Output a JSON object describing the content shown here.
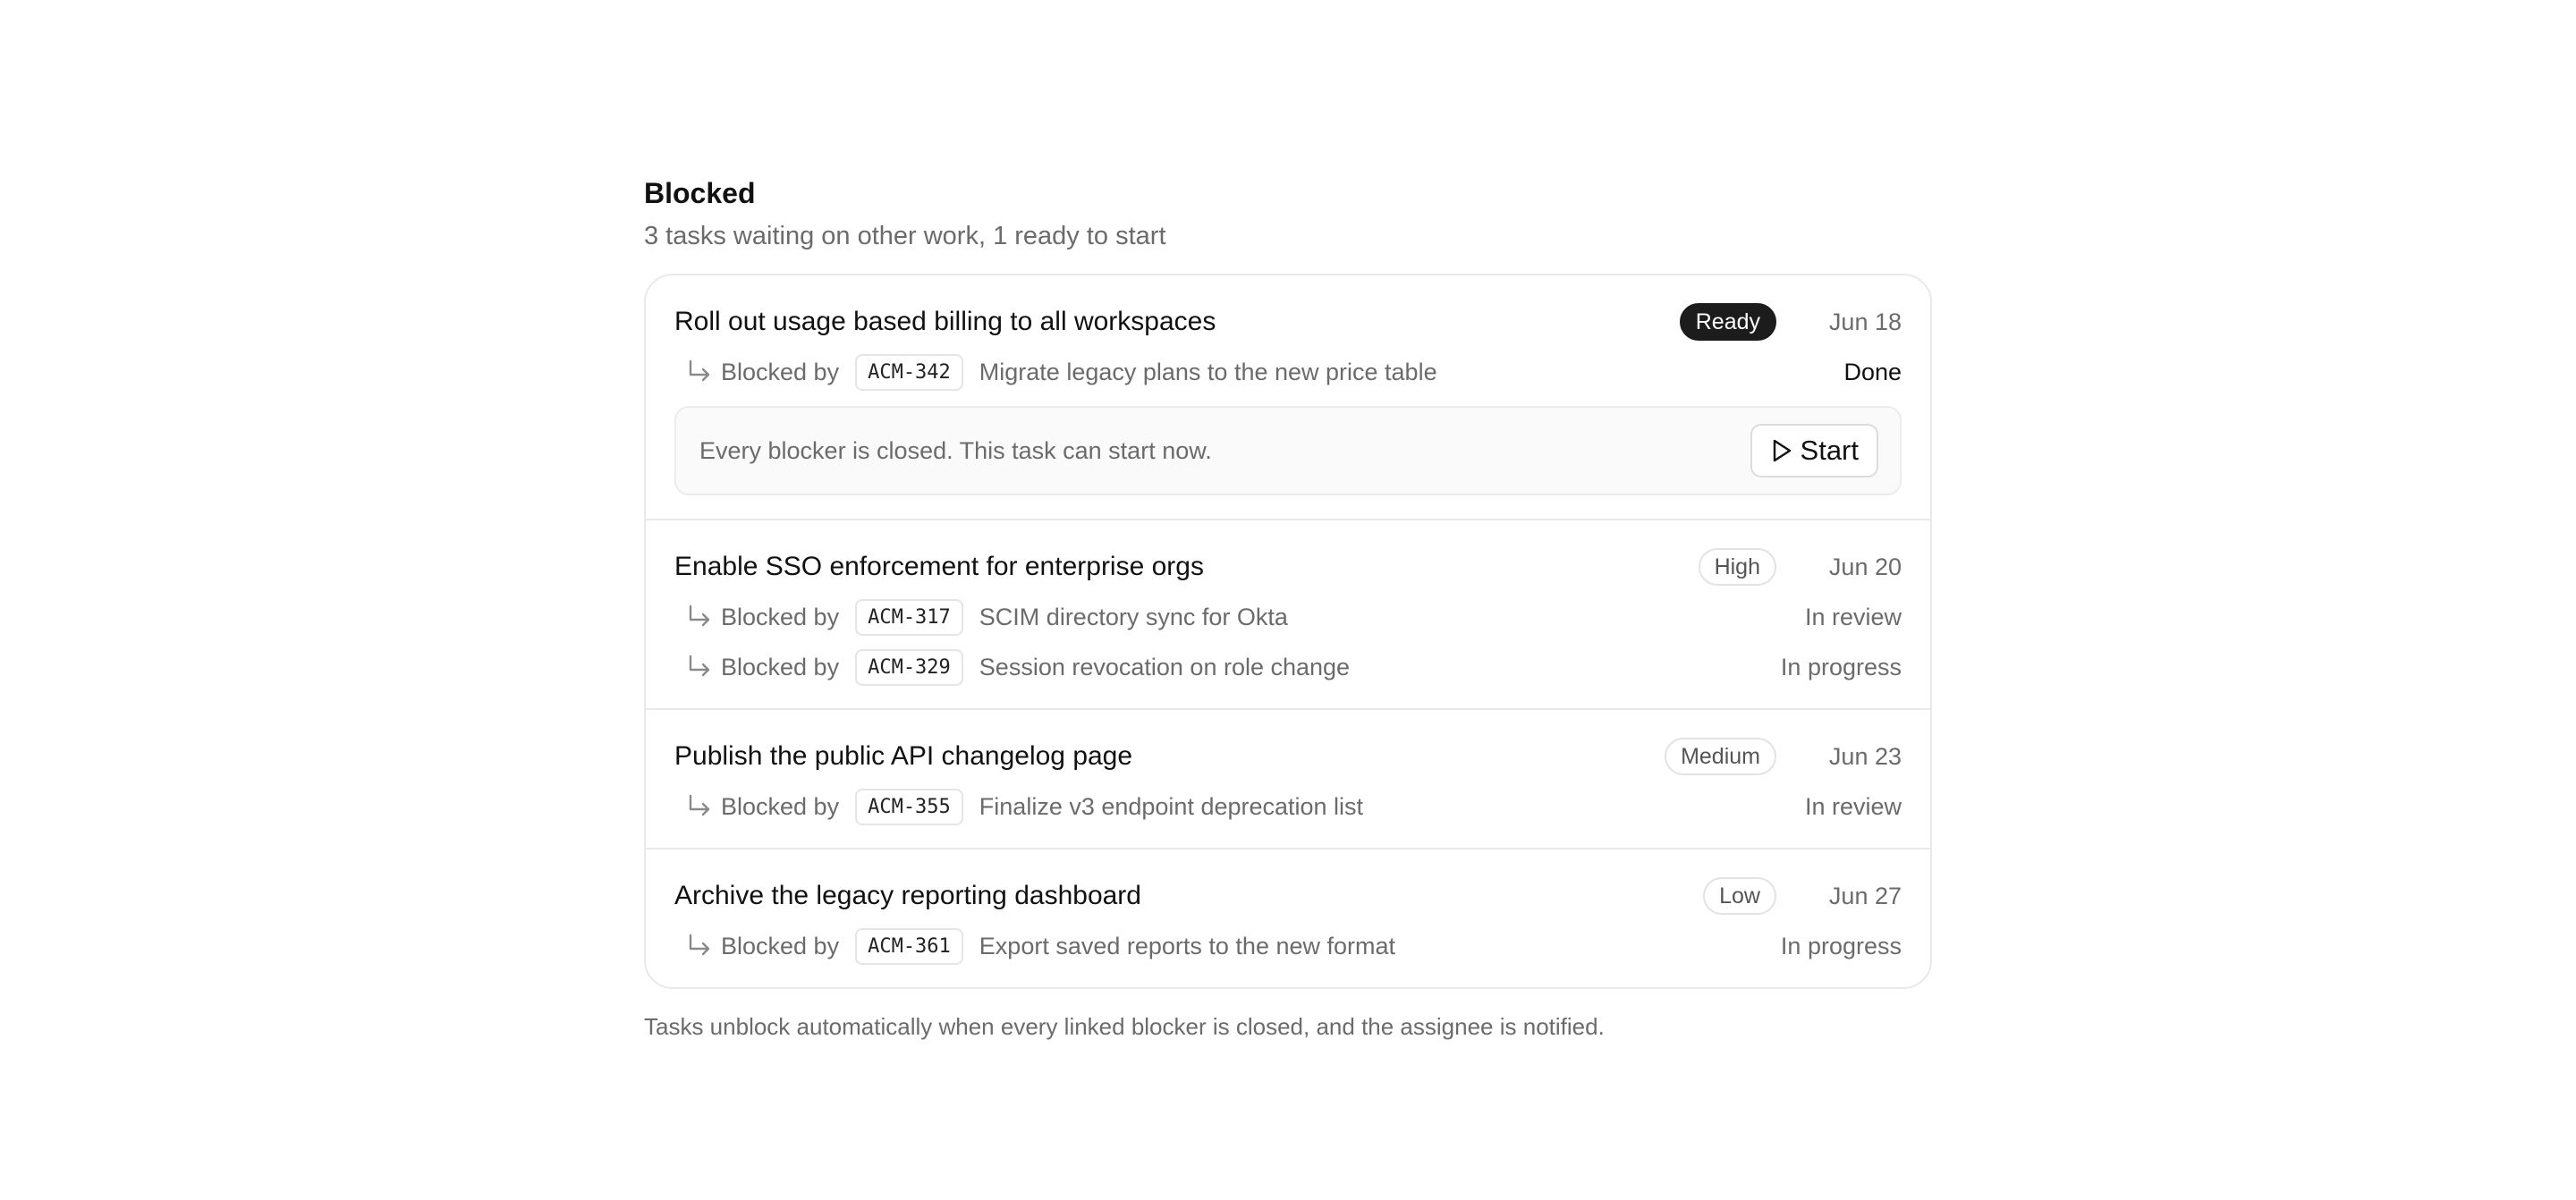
{
  "header": {
    "title": "Blocked",
    "subtitle": "3 tasks waiting on other work, 1 ready to start"
  },
  "tasks": [
    {
      "title": "Roll out usage based billing to all workspaces",
      "badge": "Ready",
      "due": "Jun 18",
      "blockers": [
        {
          "label": "Blocked by",
          "code": "ACM-342",
          "title": "Migrate legacy plans to the new price table",
          "status": "Done"
        }
      ],
      "ready_message": "Every blocker is closed. This task can start now.",
      "start_label": "Start"
    },
    {
      "title": "Enable SSO enforcement for enterprise orgs",
      "badge": "High",
      "due": "Jun 20",
      "blockers": [
        {
          "label": "Blocked by",
          "code": "ACM-317",
          "title": "SCIM directory sync for Okta",
          "status": "In review"
        },
        {
          "label": "Blocked by",
          "code": "ACM-329",
          "title": "Session revocation on role change",
          "status": "In progress"
        }
      ]
    },
    {
      "title": "Publish the public API changelog page",
      "badge": "Medium",
      "due": "Jun 23",
      "blockers": [
        {
          "label": "Blocked by",
          "code": "ACM-355",
          "title": "Finalize v3 endpoint deprecation list",
          "status": "In review"
        }
      ]
    },
    {
      "title": "Archive the legacy reporting dashboard",
      "badge": "Low",
      "due": "Jun 27",
      "blockers": [
        {
          "label": "Blocked by",
          "code": "ACM-361",
          "title": "Export saved reports to the new format",
          "status": "In progress"
        }
      ]
    }
  ],
  "footnote": "Tasks unblock automatically when every linked blocker is closed, and the assignee is notified.",
  "icons": {
    "blocker": "arrow-turn-down-right-icon",
    "start": "play-icon"
  },
  "colors": {
    "ready_badge_bg": "#1c1c1c",
    "muted_text": "#6b6b6b",
    "border": "#e9e9e9"
  }
}
